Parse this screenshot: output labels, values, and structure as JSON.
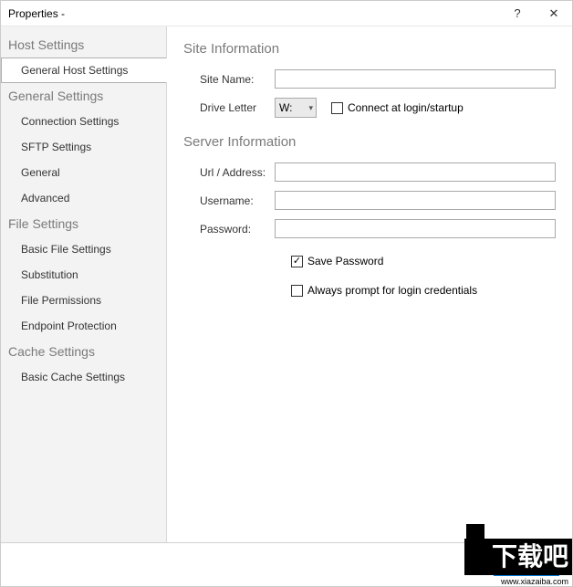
{
  "window": {
    "title": "Properties -",
    "help": "?",
    "close": "✕"
  },
  "sidebar": {
    "sections": [
      {
        "header": "Host Settings",
        "items": [
          {
            "label": "General Host Settings",
            "selected": true
          }
        ]
      },
      {
        "header": "General Settings",
        "items": [
          {
            "label": "Connection Settings"
          },
          {
            "label": "SFTP Settings"
          },
          {
            "label": "General"
          },
          {
            "label": "Advanced"
          }
        ]
      },
      {
        "header": "File Settings",
        "items": [
          {
            "label": "Basic File Settings"
          },
          {
            "label": "Substitution"
          },
          {
            "label": "File Permissions"
          },
          {
            "label": "Endpoint Protection"
          }
        ]
      },
      {
        "header": "Cache Settings",
        "items": [
          {
            "label": "Basic Cache Settings"
          }
        ]
      }
    ]
  },
  "main": {
    "site_info": {
      "title": "Site Information",
      "site_name_label": "Site Name:",
      "site_name_value": "",
      "drive_letter_label": "Drive Letter",
      "drive_letter_value": "W:",
      "connect_startup_label": "Connect at login/startup",
      "connect_startup_checked": false
    },
    "server_info": {
      "title": "Server Information",
      "url_label": "Url / Address:",
      "url_value": "",
      "username_label": "Username:",
      "username_value": "",
      "password_label": "Password:",
      "password_value": "",
      "save_password_label": "Save Password",
      "save_password_checked": true,
      "always_prompt_label": "Always prompt for login credentials",
      "always_prompt_checked": false
    }
  },
  "watermark": {
    "big": "下载吧",
    "url": "www.xiazaiba.com"
  }
}
